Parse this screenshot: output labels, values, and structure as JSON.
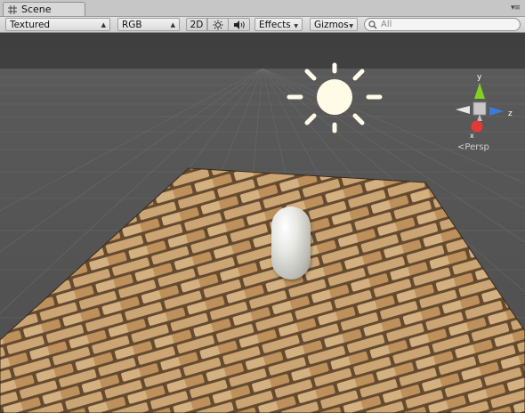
{
  "tab": {
    "label": "Scene",
    "icon": "grid-icon"
  },
  "toolbar": {
    "render_mode": "Textured",
    "channel": "RGB",
    "mode_2d": "2D",
    "lighting_icon": "sun-icon",
    "audio_icon": "speaker-icon",
    "effects_label": "Effects",
    "gizmos_label": "Gizmos",
    "search_placeholder": "All"
  },
  "gizmo": {
    "y": "y",
    "z": "z",
    "x": "x",
    "projection": "Persp"
  },
  "colors": {
    "viewport_bg": "#404040",
    "grid_line": "#5a5a5a",
    "sun": "#fffbe6",
    "axis_y": "#7ed321",
    "axis_z": "#3a7bd5",
    "axis_x": "#e53935"
  }
}
